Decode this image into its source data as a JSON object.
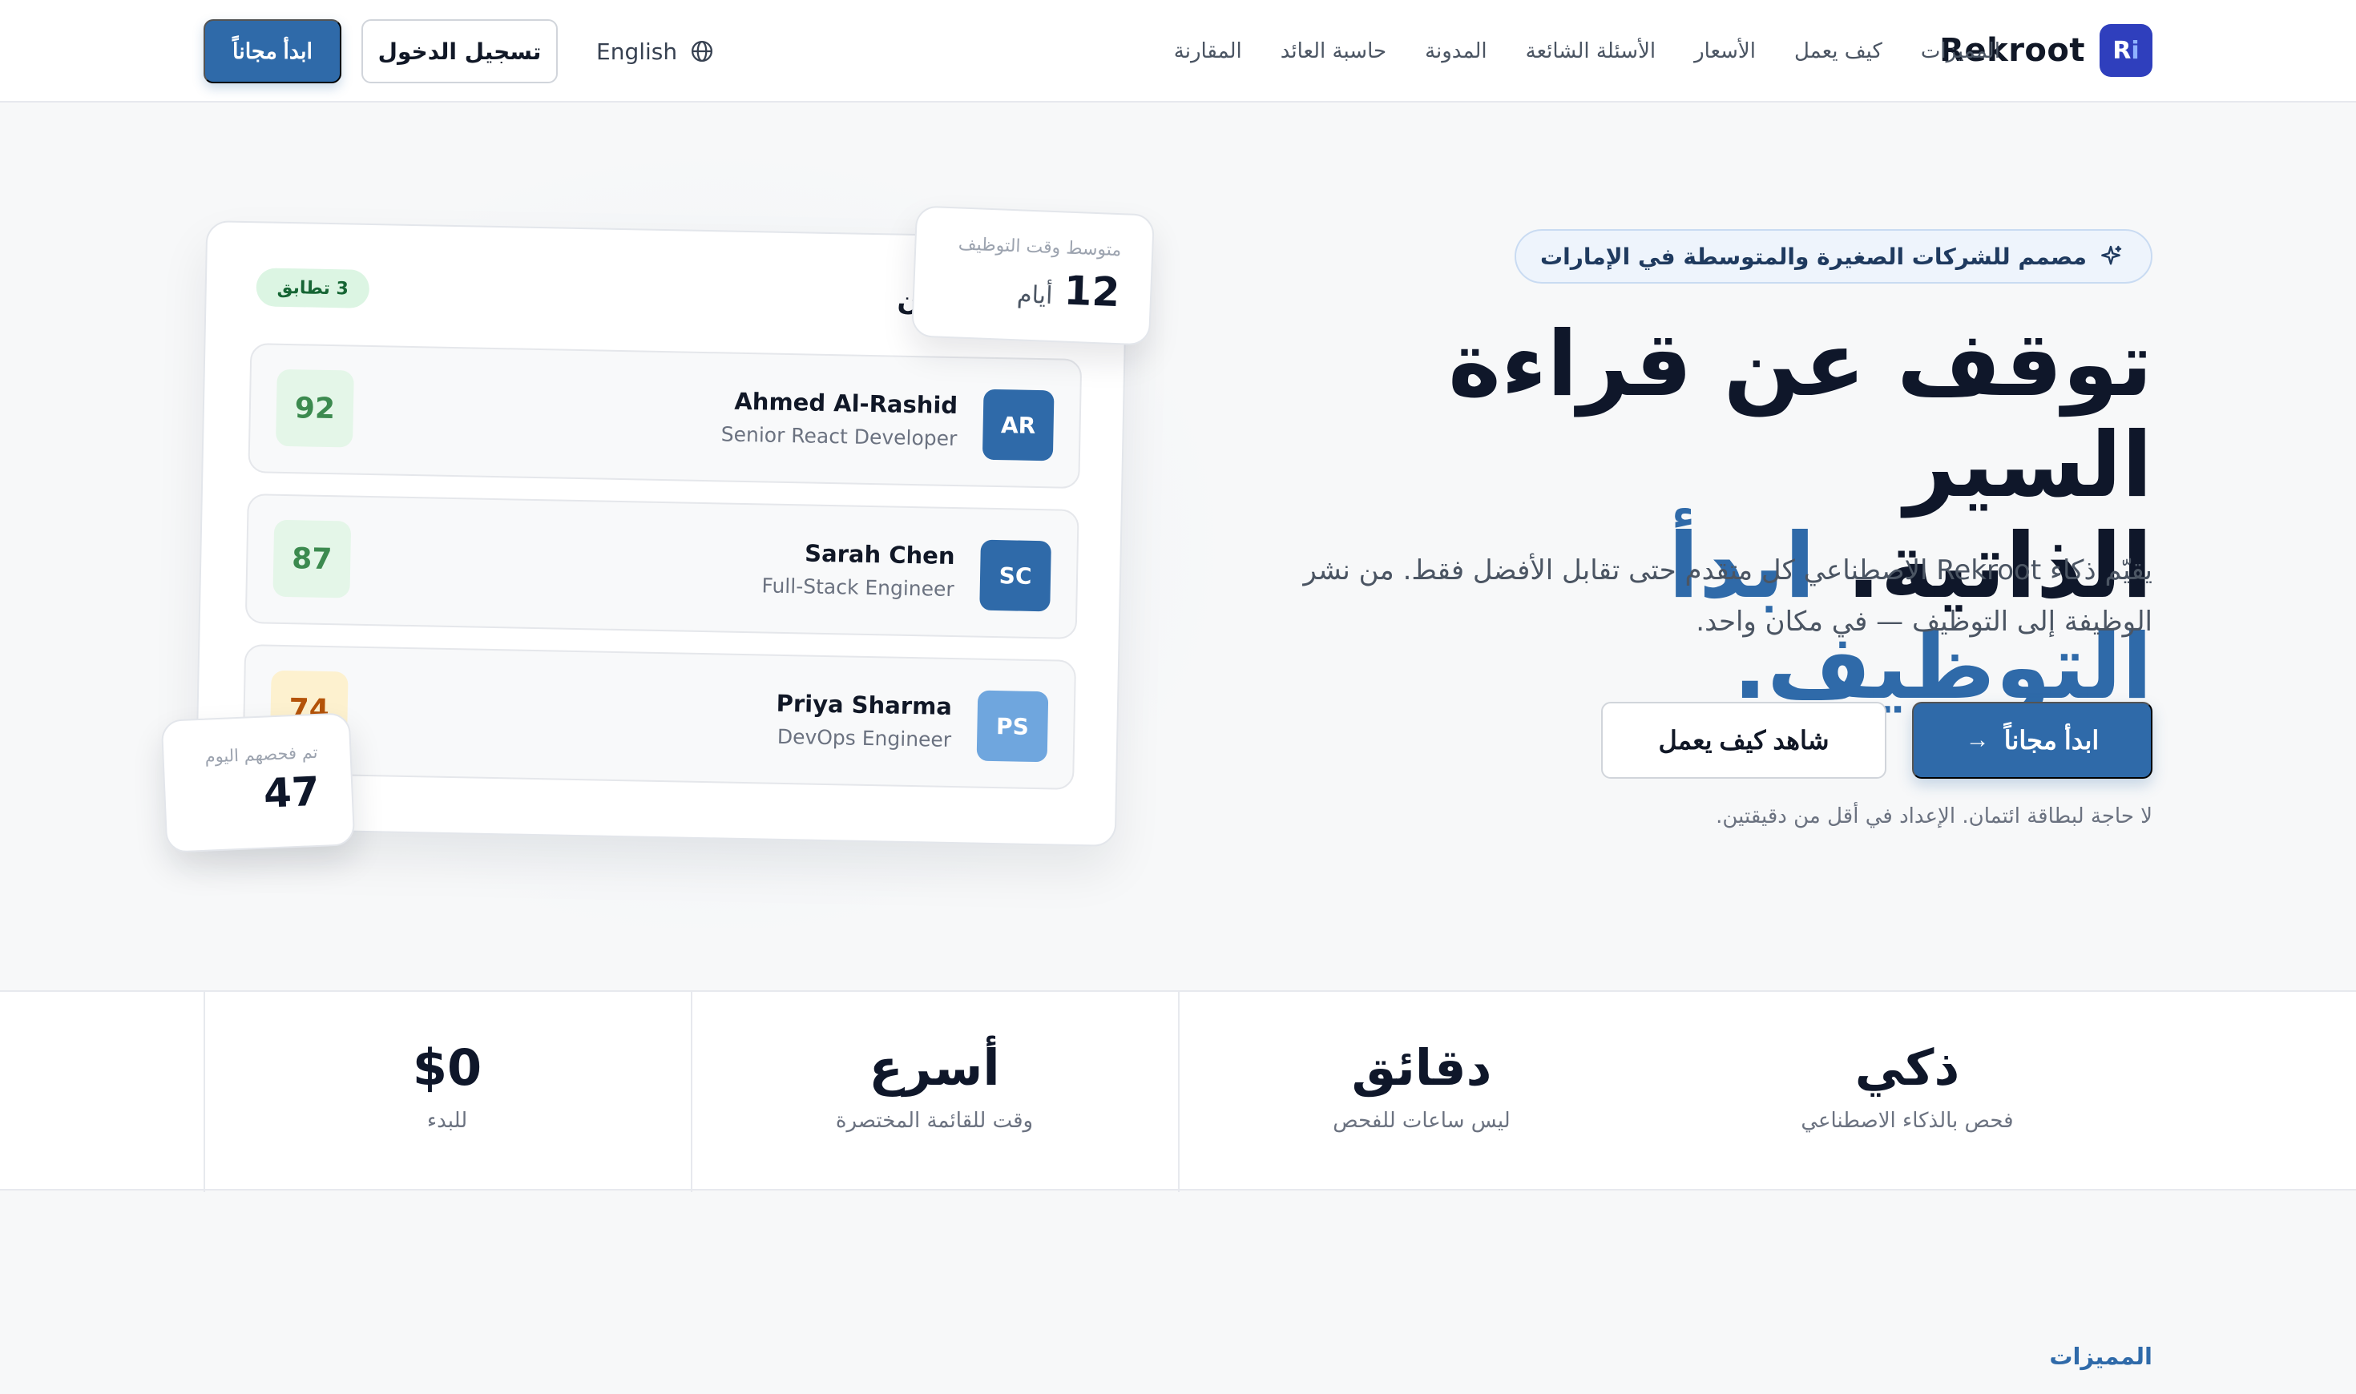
{
  "header": {
    "logo_text": "Rekroot",
    "logo_mark": "R",
    "nav": [
      "المميزات",
      "كيف يعمل",
      "الأسعار",
      "الأسئلة الشائعة",
      "المدونة",
      "حاسبة العائد",
      "المقارنة"
    ],
    "language_label": "English",
    "login_label": "تسجيل الدخول",
    "start_label": "ابدأ مجاناً"
  },
  "hero": {
    "badge": "مصمم للشركات الصغيرة والمتوسطة في الإمارات",
    "title_line1": "توقف عن قراءة السير",
    "title_line2_plain": "الذاتية.",
    "title_line2_accent": "ابدأ التوظيف.",
    "subtitle_line1": "يقيّم ذكاء Rekroot الاصطناعي كل متقدم حتى تقابل الأفضل فقط. من نشر",
    "subtitle_line2": "الوظيفة إلى التوظيف — في مكان واحد.",
    "cta_primary": "ابدأ مجاناً",
    "cta_secondary": "شاهد كيف يعمل",
    "note": "لا حاجة لبطاقة ائتمان. الإعداد في أقل من دقيقتين."
  },
  "mockup": {
    "match_pill": "3 تطابق",
    "header_fragment": "ن",
    "candidates": [
      {
        "initials": "AR",
        "name": "Ahmed Al-Rashid",
        "role": "Senior React Developer",
        "score": "92",
        "avatar_color": "#2f6aa9",
        "score_bg": "#e4f6e8",
        "score_color": "#3c8a4f"
      },
      {
        "initials": "SC",
        "name": "Sarah Chen",
        "role": "Full-Stack Engineer",
        "score": "87",
        "avatar_color": "#2f6aa9",
        "score_bg": "#e4f6e8",
        "score_color": "#3c8a4f"
      },
      {
        "initials": "PS",
        "name": "Priya Sharma",
        "role": "DevOps Engineer",
        "score": "74",
        "avatar_color": "#6fa6de",
        "score_bg": "#fdf1cf",
        "score_color": "#b45309"
      }
    ],
    "time_label": "متوسط وقت التوظيف",
    "time_value": "12",
    "time_unit": "أيام",
    "scanned_label": "تم فحصهم اليوم",
    "scanned_value": "47"
  },
  "stats": [
    {
      "big": "ذكي",
      "small": "فحص بالذكاء الاصطناعي"
    },
    {
      "big": "دقائق",
      "small": "ليس ساعات للفحص"
    },
    {
      "big": "أسرع",
      "small": "وقت للقائمة المختصرة"
    },
    {
      "big": "$0",
      "small": "للبدء"
    }
  ],
  "features_label": "المميزات",
  "colors": {
    "accent": "#2f6aa9",
    "brand_mark": "#2f3fbd",
    "match_green": "#166534"
  }
}
